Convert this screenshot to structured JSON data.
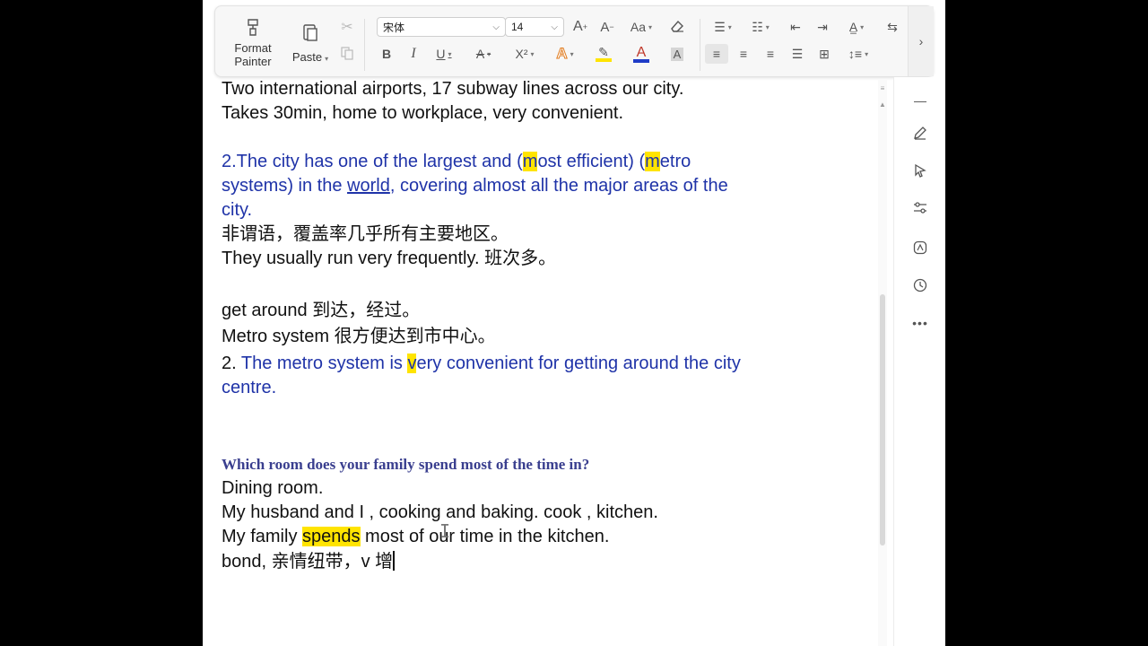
{
  "toolbar": {
    "format_painter_line1": "Format",
    "format_painter_line2": "Painter",
    "paste_label": "Paste",
    "font_name": "宋体",
    "font_size": "14",
    "aa_label": "Aa",
    "bold": "B",
    "italic": "I",
    "underline": "U",
    "strike": "A",
    "superscript": "X²",
    "text_effect": "A",
    "highlight": "A",
    "font_color": "A",
    "char_shade": "A"
  },
  "colors": {
    "highlight": "#ffe400",
    "font_color_bar": "#1f3cc7",
    "highlight_bar": "#ffe400",
    "body_blue": "#1f33a8"
  },
  "doc": {
    "l1": "Two international airports, 17 subway lines across our city.",
    "l2": "Takes 30min, home to workplace, very convenient.",
    "p2_a": "2.The city has one of the largest and (",
    "p2_hl1": "m",
    "p2_b": "ost efficient) (",
    "p2_hl2": "m",
    "p2_c": "etro",
    "p2_d": "systems) in the ",
    "p2_world": "world",
    "p2_e": ", covering almost all the major areas of the",
    "p2_f": "city.",
    "cn1": "非谓语，覆盖率几乎所有主要地区。",
    "l_freq": "They usually run very frequently. 班次多。",
    "l_get": "get around 到达，经过。",
    "l_metro": "Metro system 很方便达到市中心。",
    "p3_num": "2. ",
    "p3_a": "The metro system is ",
    "p3_hl": "v",
    "p3_b": "ery convenient for getting around the city",
    "p3_c": "centre.",
    "question": "Which room does your family spend most of the time in?",
    "l_dining": "Dining room.",
    "l_husband": "My husband and I , cooking and baking.  cook , kitchen.",
    "l_fam_a": "My family ",
    "l_fam_hl": "spends",
    "l_fam_b": " most of our time in the kitchen.",
    "l_bond": "bond, 亲情纽带，v 增"
  }
}
